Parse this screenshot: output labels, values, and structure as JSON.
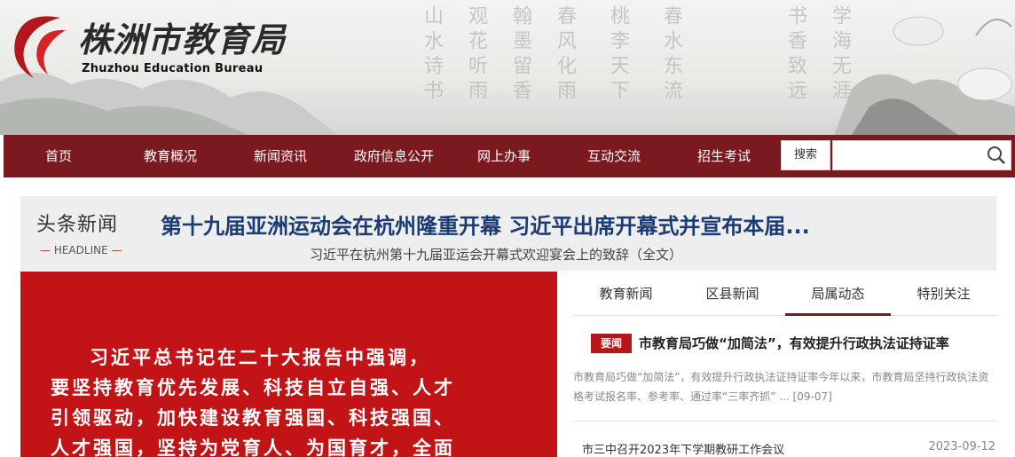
{
  "header": {
    "logo_title": "株洲市教育局",
    "logo_en": "Zhuzhou Education Bureau",
    "calligraphy": [
      "山水诗书",
      "观花听雨",
      "翰墨留香",
      "春风化雨",
      "桃李天下",
      "春水东流",
      "书香致远",
      "学海无涯"
    ]
  },
  "nav": {
    "items": [
      "首页",
      "教育概况",
      "新闻资讯",
      "政府信息公开",
      "网上办事",
      "互动交流",
      "招生考试"
    ],
    "search_label": "搜索",
    "search_placeholder": "",
    "search_value": ""
  },
  "headline": {
    "label_cn": "头条新闻",
    "label_en": "HEADLINE",
    "title": "第十九届亚洲运动会在杭州隆重开幕 习近平出席开幕式并宣布本届...",
    "subtitle": "习近平在杭州第十九届亚运会开幕式欢迎宴会上的致辞（全文）"
  },
  "red_panel": {
    "lines": [
      "习近平总书记在二十大报告中强调，",
      "要坚持教育优先发展、科技自立自强、人才",
      "引领驱动，加快建设教育强国、科技强国、",
      "人才强国，坚持为党育人、为国育才，全面"
    ]
  },
  "tabs": {
    "items": [
      "教育新闻",
      "区县新闻",
      "局属动态",
      "特别关注"
    ],
    "active_index": 2
  },
  "feature": {
    "badge": "要闻",
    "title": "市教育局巧做“加简法”，有效提升行政执法证持证率",
    "desc": "市教育局巧做“加简法”，有效提升行政执法证持证率今年以来，市教育局坚持行政执法资格考试报名率、参考率、通过率“三率齐抓”",
    "more": "...",
    "date": "[09-07]"
  },
  "news_list": [
    {
      "title": "市三中召开2023年下学期教研工作会议",
      "date": "2023-09-12"
    }
  ],
  "colors": {
    "nav_bg": "#7b1a1e",
    "headline_title": "#1b3c73",
    "red_panel": "#c21317",
    "badge": "#b3161b"
  }
}
